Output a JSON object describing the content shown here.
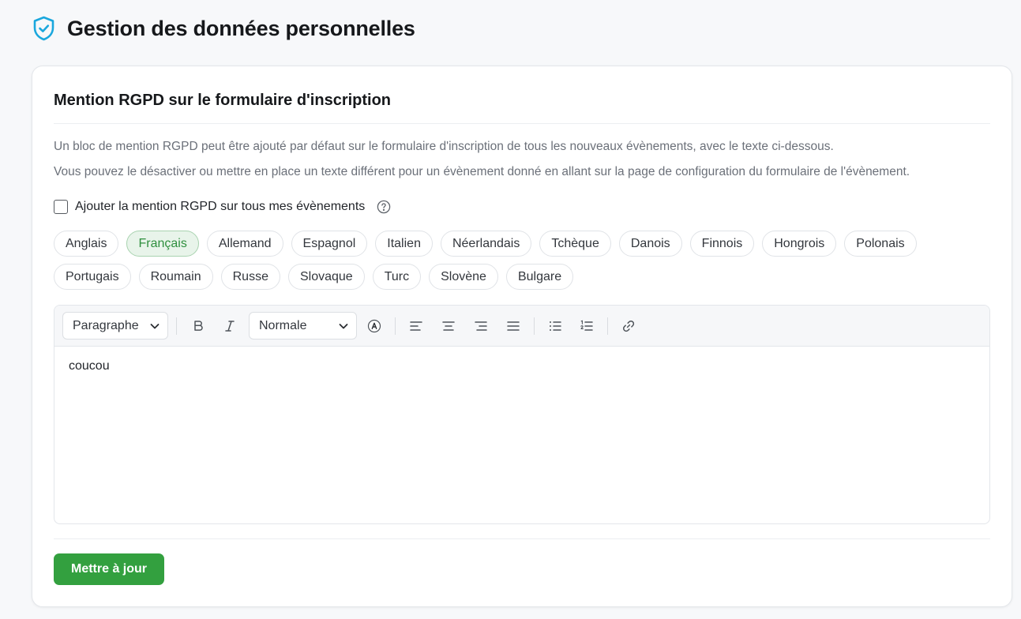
{
  "page": {
    "title": "Gestion des données personnelles",
    "icon": "shield-check-icon"
  },
  "card": {
    "title": "Mention RGPD sur le formulaire d'inscription",
    "description_1": "Un bloc de mention RGPD peut être ajouté par défaut sur le formulaire d'inscription de tous les nouveaux évènements, avec le texte ci-dessous.",
    "description_2": "Vous pouvez le désactiver ou mettre en place un texte différent pour un évènement donné en allant sur la page de configuration du formulaire de l'évènement.",
    "checkbox_label": "Ajouter la mention RGPD sur tous mes évènements",
    "checkbox_checked": false
  },
  "languages": {
    "selected": "Français",
    "items": [
      {
        "label": "Anglais"
      },
      {
        "label": "Français"
      },
      {
        "label": "Allemand"
      },
      {
        "label": "Espagnol"
      },
      {
        "label": "Italien"
      },
      {
        "label": "Néerlandais"
      },
      {
        "label": "Tchèque"
      },
      {
        "label": "Danois"
      },
      {
        "label": "Finnois"
      },
      {
        "label": "Hongrois"
      },
      {
        "label": "Polonais"
      },
      {
        "label": "Portugais"
      },
      {
        "label": "Roumain"
      },
      {
        "label": "Russe"
      },
      {
        "label": "Slovaque"
      },
      {
        "label": "Turc"
      },
      {
        "label": "Slovène"
      },
      {
        "label": "Bulgare"
      }
    ]
  },
  "editor": {
    "block_type": "Paragraphe",
    "font_size": "Normale",
    "content": "coucou",
    "tools": [
      "bold-icon",
      "italic-icon",
      "text-color-icon",
      "align-left-icon",
      "align-center-icon",
      "align-right-icon",
      "align-justify-icon",
      "bullet-list-icon",
      "numbered-list-icon",
      "link-icon"
    ]
  },
  "actions": {
    "update_label": "Mettre à jour"
  },
  "colors": {
    "accent_green": "#33a03f",
    "selected_chip_bg": "#e8f4ea",
    "selected_chip_text": "#2f8f3e",
    "shield_icon": "#1aa7dd"
  }
}
